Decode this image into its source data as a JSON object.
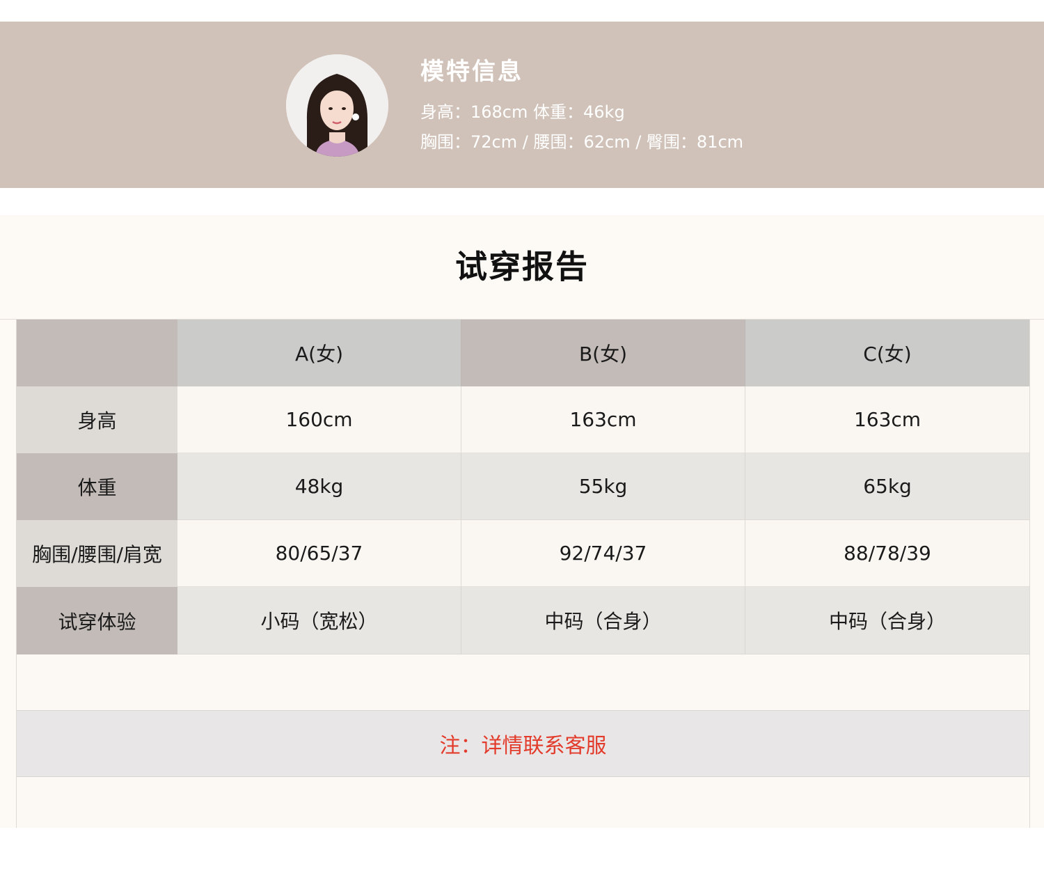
{
  "model_info": {
    "title": "模特信息",
    "line1": "身高：168cm  体重：46kg",
    "line2": "胸围：72cm / 腰围：62cm / 臀围：81cm",
    "avatar": "model-portrait"
  },
  "report": {
    "title": "试穿报告",
    "columns": [
      "",
      "A(女)",
      "B(女)",
      "C(女)"
    ],
    "rows": [
      {
        "label": "身高",
        "values": [
          "160cm",
          "163cm",
          "163cm"
        ]
      },
      {
        "label": "体重",
        "values": [
          "48kg",
          "55kg",
          "65kg"
        ]
      },
      {
        "label": "胸围/腰围/肩宽",
        "values": [
          "80/65/37",
          "92/74/37",
          "88/78/39"
        ]
      },
      {
        "label": "试穿体验",
        "values": [
          "小码（宽松）",
          "中码（合身）",
          "中码（合身）"
        ]
      }
    ],
    "note": "注：详情联系客服"
  },
  "colors": {
    "banner": "#d0c2b8",
    "report_bg": "#fdf9f4",
    "note_text": "#e33b2b"
  }
}
